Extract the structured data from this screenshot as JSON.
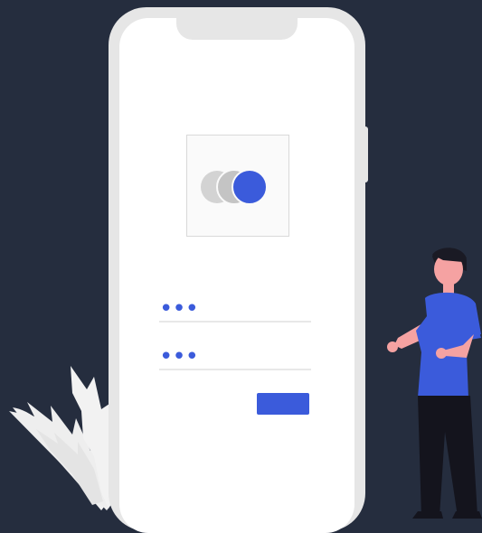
{
  "login": {
    "username_value": "•••",
    "password_value": "•••",
    "submit_label": ""
  },
  "colors": {
    "background": "#252d3e",
    "accent": "#3b5bdb",
    "phone_frame": "#e6e6e6",
    "screen": "#ffffff"
  },
  "icons": {
    "logo": "overlapping-circles-logo-icon",
    "plant": "leaf-plant-icon",
    "person": "standing-person-icon"
  }
}
